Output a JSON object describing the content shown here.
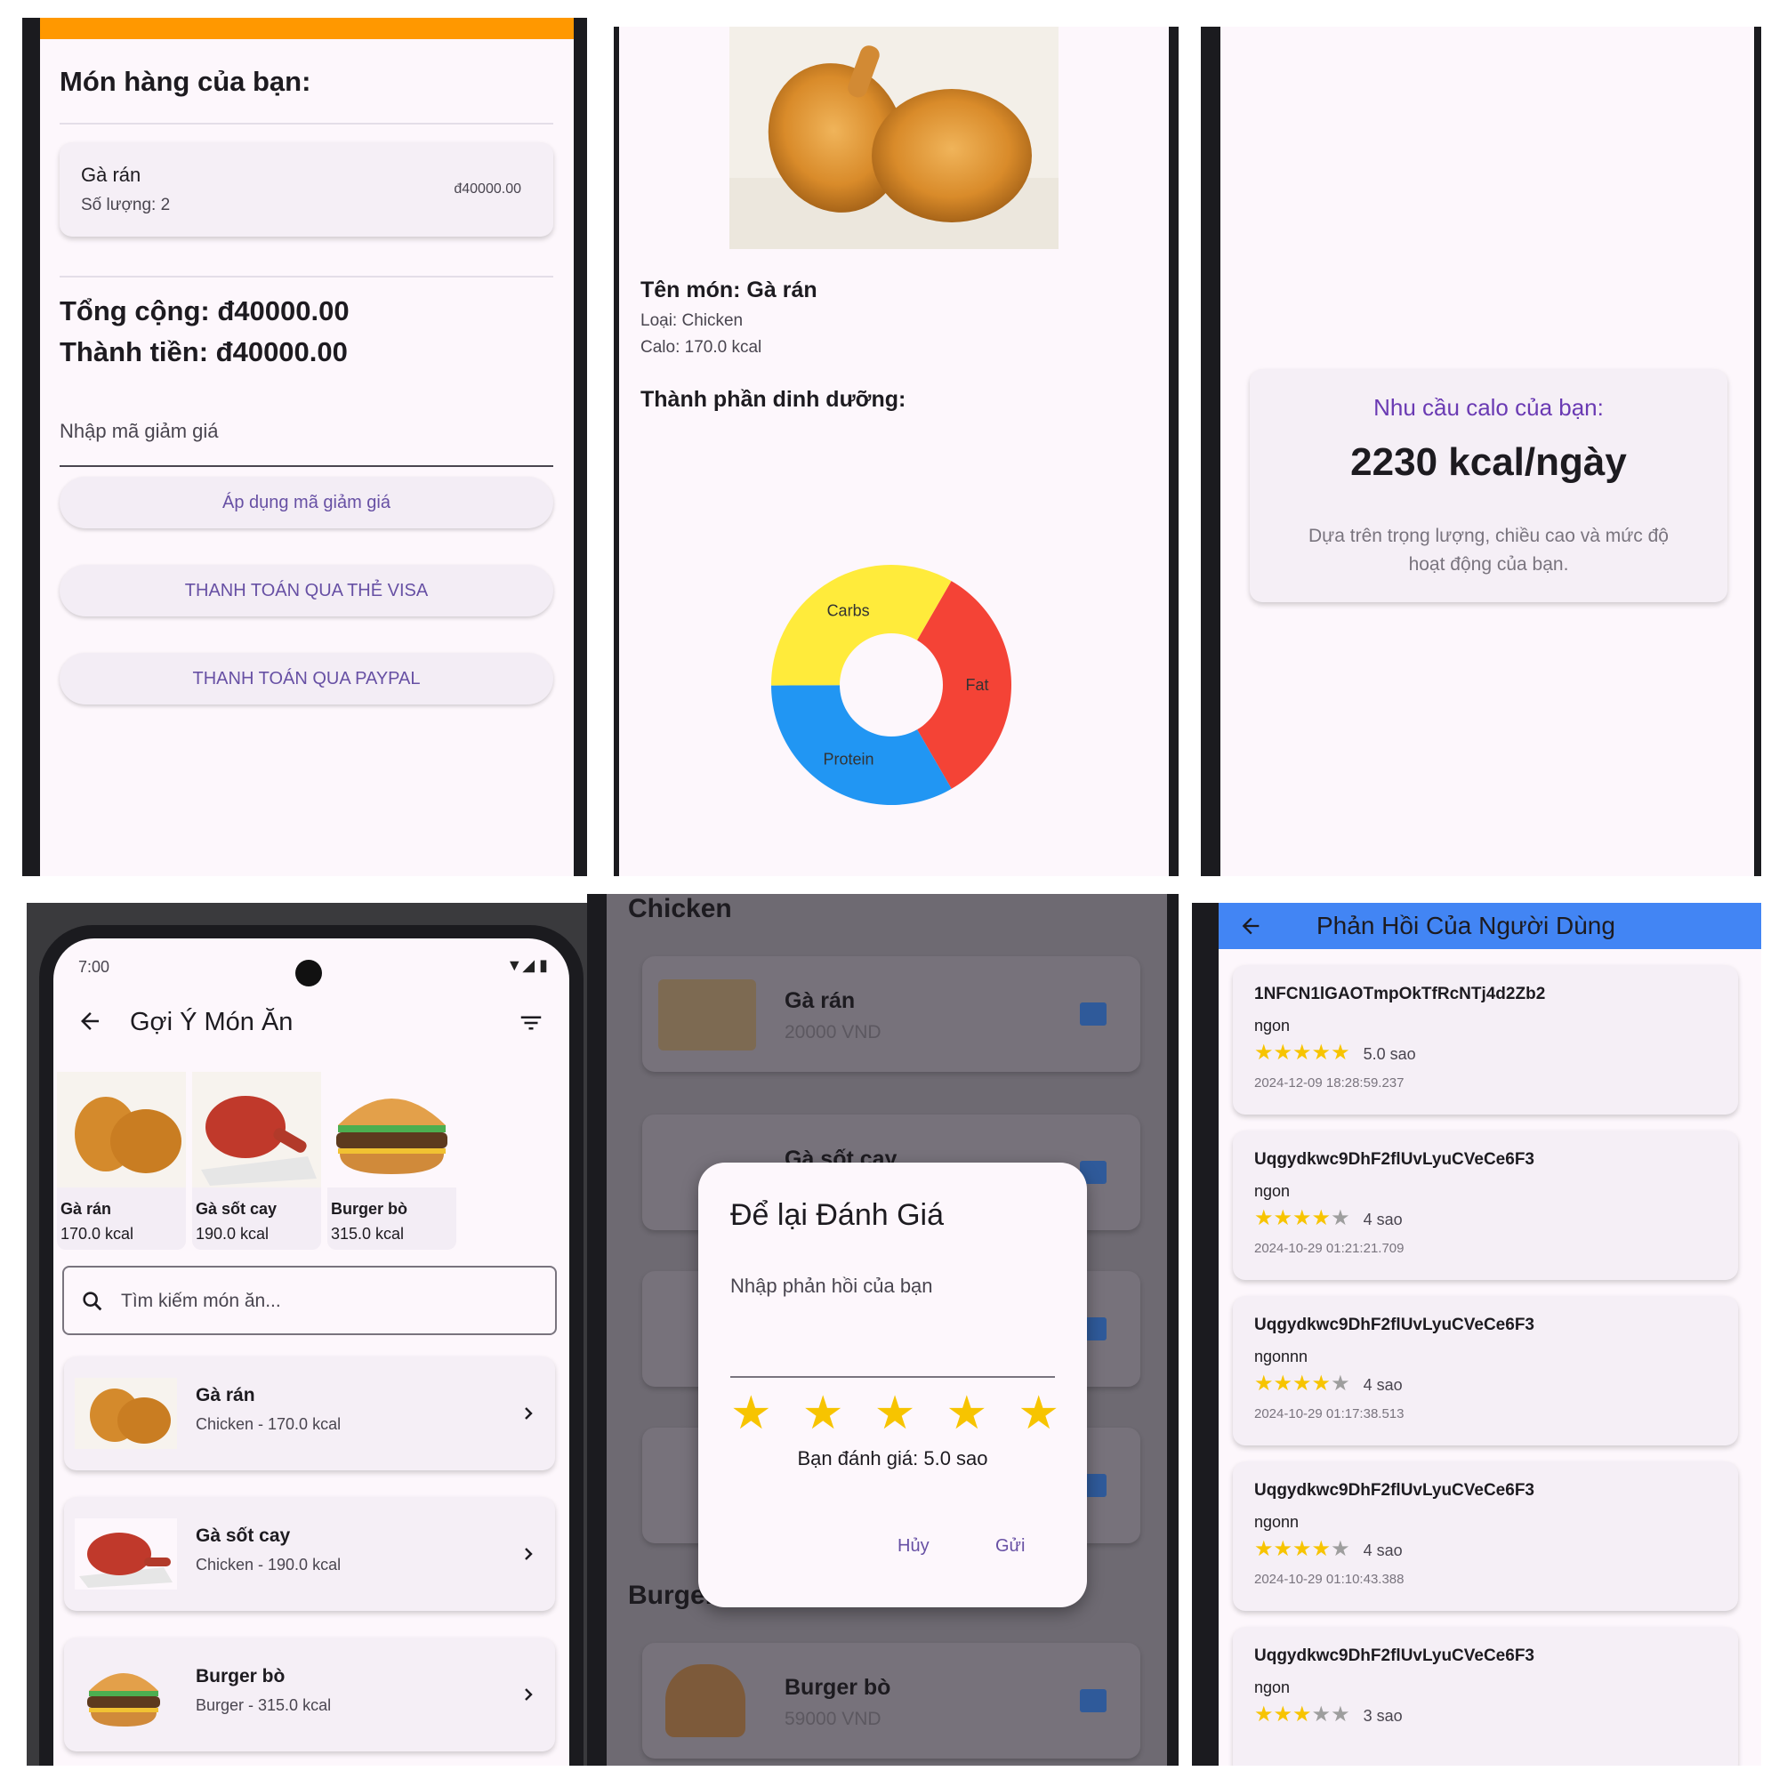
{
  "cart": {
    "title": "Món hàng của bạn:",
    "item_name": "Gà rán",
    "item_qty": "Số lượng: 2",
    "item_price": "đ40000.00",
    "total": "Tổng cộng: đ40000.00",
    "final": "Thành tiền: đ40000.00",
    "coupon_placeholder": "Nhập mã giảm giá",
    "apply_label": "Áp dụng mã giảm giá",
    "visa_label": "THANH TOÁN QUA THẺ VISA",
    "paypal_label": "THANH TOÁN QUA PAYPAL"
  },
  "detail": {
    "name": "Tên món: Gà rán",
    "type": "Loại: Chicken",
    "calo": "Calo: 170.0 kcal",
    "nutrition_title": "Thành phần dinh dưỡng:",
    "colors": {
      "fat": "#f44336",
      "protein": "#2196f3",
      "carbs": "#ffeb3b"
    }
  },
  "chart_data": {
    "type": "pie",
    "labels": [
      "Fat",
      "Protein",
      "Carbs"
    ],
    "values": [
      33.3,
      33.3,
      33.4
    ]
  },
  "calorie": {
    "label": "Nhu cầu calo của bạn:",
    "value": "2230 kcal/ngày",
    "desc_line1": "Dựa trên trọng lượng, chiều cao và mức độ",
    "desc_line2": "hoạt động của bạn."
  },
  "suggest": {
    "status_time": "7:00",
    "title": "Gợi Ý Món Ăn",
    "search_placeholder": "Tìm kiếm món ăn...",
    "featured": [
      {
        "name": "Gà rán",
        "kcal": "170.0 kcal"
      },
      {
        "name": "Gà sốt cay",
        "kcal": "190.0 kcal"
      },
      {
        "name": "Burger bò",
        "kcal": "315.0 kcal"
      }
    ],
    "list": [
      {
        "name": "Gà rán",
        "sub": "Chicken - 170.0 kcal"
      },
      {
        "name": "Gà sốt cay",
        "sub": "Chicken - 190.0 kcal"
      },
      {
        "name": "Burger bò",
        "sub": "Burger - 315.0 kcal"
      }
    ]
  },
  "review_dialog": {
    "section_chicken": "Chicken",
    "section_burger": "Burger",
    "item1_name": "Gà rán",
    "item1_price": "20000 VND",
    "item2_name": "Gà sốt cay",
    "item3_name": "Burger bò",
    "item3_price": "59000 VND",
    "title": "Để lại Đánh Giá",
    "input_label": "Nhập phản hồi của bạn",
    "rating_text": "Bạn đánh giá: 5.0 sao",
    "rating": 5,
    "cancel": "Hủy",
    "send": "Gửi"
  },
  "feedback": {
    "title": "Phản Hồi Của Người Dùng",
    "items": [
      {
        "user": "1NFCN1lGAOTmpOkTfRcNTj4d2Zb2",
        "text": "ngon",
        "stars": 5,
        "rating": "5.0 sao",
        "time": "2024-12-09 18:28:59.237"
      },
      {
        "user": "Uqgydkwc9DhF2flUvLyuCVeCe6F3",
        "text": "ngon",
        "stars": 4,
        "rating": "4 sao",
        "time": "2024-10-29 01:21:21.709"
      },
      {
        "user": "Uqgydkwc9DhF2flUvLyuCVeCe6F3",
        "text": "ngonnn",
        "stars": 4,
        "rating": "4 sao",
        "time": "2024-10-29 01:17:38.513"
      },
      {
        "user": "Uqgydkwc9DhF2flUvLyuCVeCe6F3",
        "text": "ngonn",
        "stars": 4,
        "rating": "4 sao",
        "time": "2024-10-29 01:10:43.388"
      },
      {
        "user": "Uqgydkwc9DhF2flUvLyuCVeCe6F3",
        "text": "ngon",
        "stars": 3,
        "rating": "3 sao",
        "time": ""
      }
    ]
  }
}
